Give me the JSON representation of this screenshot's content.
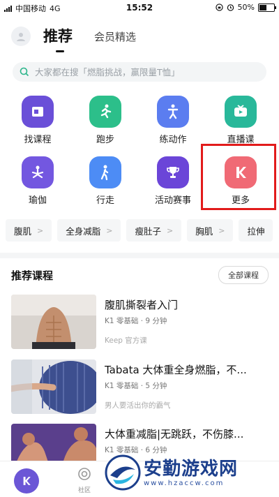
{
  "status_bar": {
    "carrier": "中国移动",
    "network": "4G",
    "time": "15:52",
    "battery": "50%",
    "battery_level": 0.5
  },
  "header": {
    "tab_active": "推荐",
    "tab_other": "会员精选"
  },
  "search": {
    "placeholder": "大家都在搜「燃脂挑战，赢限量T恤」"
  },
  "grid": [
    {
      "label": "找课程",
      "color": "#6a4fd8",
      "icon": "course-icon"
    },
    {
      "label": "跑步",
      "color": "#2cbf8a",
      "icon": "running-icon"
    },
    {
      "label": "练动作",
      "color": "#5b7df0",
      "icon": "exercise-icon"
    },
    {
      "label": "直播课",
      "color": "#29b89a",
      "icon": "tv-icon"
    },
    {
      "label": "瑜伽",
      "color": "#7357e0",
      "icon": "yoga-icon"
    },
    {
      "label": "行走",
      "color": "#4d8cf5",
      "icon": "walking-icon"
    },
    {
      "label": "活动赛事",
      "color": "#6b45d8",
      "icon": "trophy-icon"
    },
    {
      "label": "更多",
      "color": "#f06a75",
      "icon": "keep-logo-icon"
    }
  ],
  "chips": [
    "腹肌",
    "全身减脂",
    "瘦肚子",
    "胸肌",
    "拉伸"
  ],
  "section": {
    "title": "推荐课程",
    "all_button": "全部课程"
  },
  "courses": [
    {
      "title": "腹肌撕裂者入门",
      "meta": "K1 零基础 · 9 分钟",
      "source": "Keep 官方课"
    },
    {
      "title": "Tabata 大体重全身燃脂，不...",
      "meta": "K1 零基础 · 5 分钟",
      "source": "男人要活出你的霸气"
    },
    {
      "title": "大体重减脂|无跳跃，不伤膝...",
      "meta": "K1 零基础 · 6 分钟",
      "source": ""
    }
  ],
  "bottom_nav": {
    "community": "社区"
  },
  "watermark": {
    "name": "安勤游戏网",
    "url": "www.hzaccw.com"
  }
}
